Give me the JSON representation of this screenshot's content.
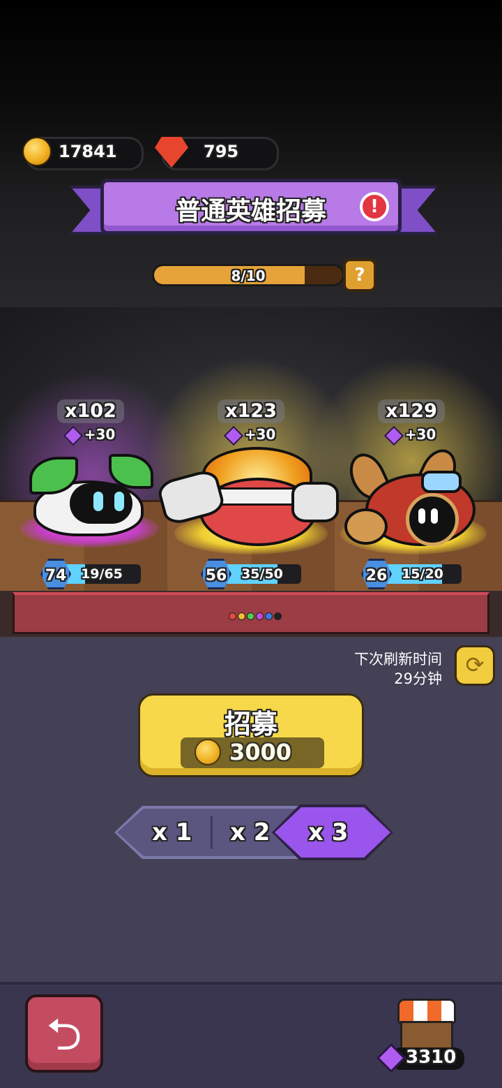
{
  "currency": {
    "coins": "17841",
    "gems": "795"
  },
  "title": {
    "text": "普通英雄招募",
    "alert_icon": "!"
  },
  "progress": {
    "text": "8/10",
    "fraction": 0.8,
    "help_icon": "?"
  },
  "heroes": [
    {
      "count": "x102",
      "gem_bonus": "+30",
      "level": "74",
      "xp": "19/65",
      "xp_fraction": 0.29,
      "glow": "#c04fe0"
    },
    {
      "count": "x123",
      "gem_bonus": "+30",
      "level": "56",
      "xp": "35/50",
      "xp_fraction": 0.7,
      "glow": "#f0c030"
    },
    {
      "count": "x129",
      "gem_bonus": "+30",
      "level": "26",
      "xp": "15/20",
      "xp_fraction": 0.75,
      "glow": "#f0c030"
    }
  ],
  "page_dots": [
    "#e64a3c",
    "#f0c030",
    "#4ad04a",
    "#c04fe0",
    "#3a7ae0",
    "#222222"
  ],
  "refresh": {
    "label": "下次刷新时间",
    "time": "29分钟",
    "icon": "refresh-icon"
  },
  "recruit": {
    "label": "招募",
    "price": "3000"
  },
  "multipliers": {
    "options": [
      "x 1",
      "x 2",
      "x 3"
    ],
    "selected": "x 3"
  },
  "bottom": {
    "back_icon": "back-arrow-icon",
    "shop_icon": "shop-icon",
    "shop_gems": "3310"
  }
}
